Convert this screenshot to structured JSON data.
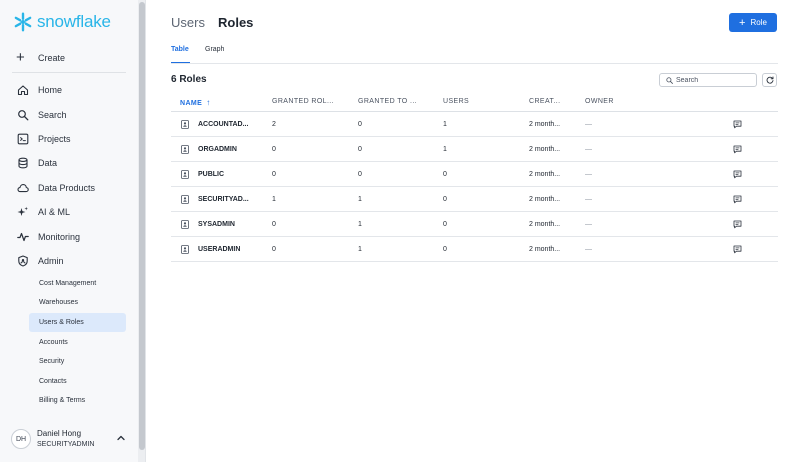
{
  "app": {
    "brand": "snowflake",
    "brand_color": "#29b5e8",
    "accent_color": "#1f6fe0"
  },
  "sidebar": {
    "create_label": "Create",
    "nav": [
      {
        "label": "Home",
        "icon": "home-icon"
      },
      {
        "label": "Search",
        "icon": "search-icon"
      },
      {
        "label": "Projects",
        "icon": "code-icon"
      },
      {
        "label": "Data",
        "icon": "database-icon"
      },
      {
        "label": "Data Products",
        "icon": "cloud-icon"
      },
      {
        "label": "AI & ML",
        "icon": "sparkle-icon"
      },
      {
        "label": "Monitoring",
        "icon": "pulse-icon"
      },
      {
        "label": "Admin",
        "icon": "shield-icon"
      }
    ],
    "admin_items": [
      {
        "label": "Cost Management"
      },
      {
        "label": "Warehouses"
      },
      {
        "label": "Users & Roles",
        "active": true
      },
      {
        "label": "Accounts"
      },
      {
        "label": "Security"
      },
      {
        "label": "Contacts"
      },
      {
        "label": "Billing & Terms"
      }
    ],
    "user": {
      "initials": "DH",
      "name": "Daniel Hong",
      "role": "SECURITYADMIN"
    }
  },
  "header": {
    "breadcrumb_parent": "Users",
    "title": "Roles",
    "add_button_label": "Role"
  },
  "tabs": [
    {
      "label": "Table",
      "active": true
    },
    {
      "label": "Graph",
      "active": false
    }
  ],
  "table": {
    "title": "6 Roles",
    "search_placeholder": "Search",
    "columns": [
      "NAME",
      "GRANTED ROL...",
      "GRANTED TO ...",
      "USERS",
      "CREAT...",
      "OWNER"
    ],
    "rows": [
      {
        "name": "ACCOUNTAD...",
        "granted_roles": "2",
        "granted_to": "0",
        "users": "1",
        "created": "2 month...",
        "owner": "—"
      },
      {
        "name": "ORGADMIN",
        "granted_roles": "0",
        "granted_to": "0",
        "users": "1",
        "created": "2 month...",
        "owner": "—"
      },
      {
        "name": "PUBLIC",
        "granted_roles": "0",
        "granted_to": "0",
        "users": "0",
        "created": "2 month...",
        "owner": "—"
      },
      {
        "name": "SECURITYAD...",
        "granted_roles": "1",
        "granted_to": "1",
        "users": "0",
        "created": "2 month...",
        "owner": "—"
      },
      {
        "name": "SYSADMIN",
        "granted_roles": "0",
        "granted_to": "1",
        "users": "0",
        "created": "2 month...",
        "owner": "—"
      },
      {
        "name": "USERADMIN",
        "granted_roles": "0",
        "granted_to": "1",
        "users": "0",
        "created": "2 month...",
        "owner": "—"
      }
    ]
  }
}
